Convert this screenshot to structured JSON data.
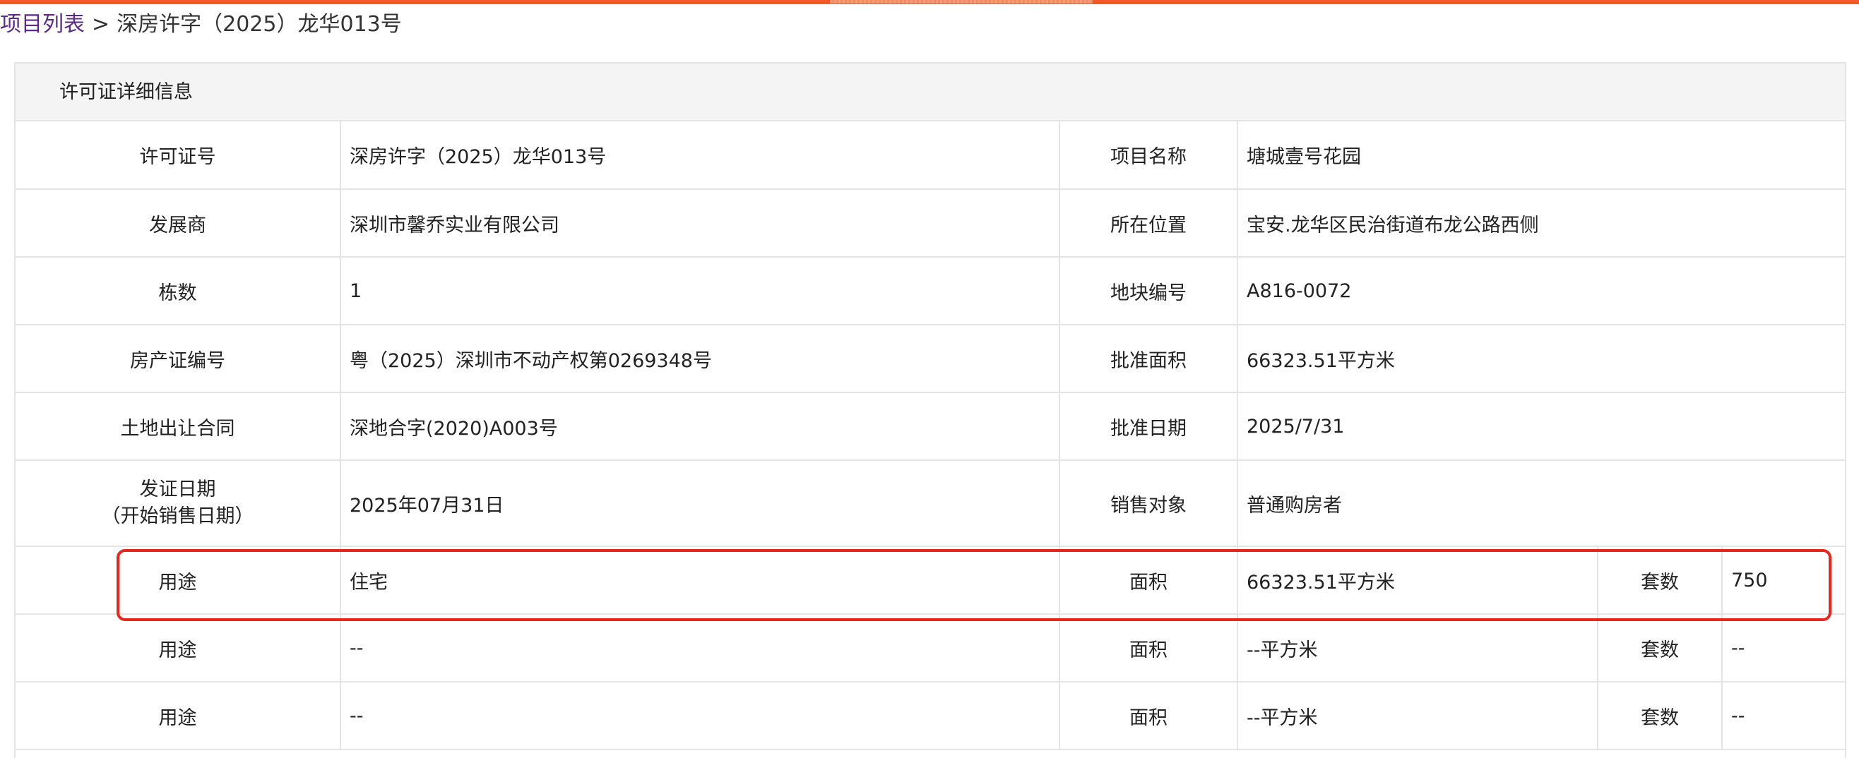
{
  "breadcrumb": {
    "link": "项目列表",
    "separator": ">",
    "current": "深房许字（2025）龙华013号"
  },
  "panel": {
    "title": "许可证详细信息"
  },
  "rows": [
    {
      "l1": "许可证号",
      "v1": "深房许字（2025）龙华013号",
      "l2": "项目名称",
      "v2": "塘城壹号花园"
    },
    {
      "l1": "发展商",
      "v1": "深圳市馨乔实业有限公司",
      "l2": "所在位置",
      "v2": "宝安.龙华区民治街道布龙公路西侧"
    },
    {
      "l1": "栋数",
      "v1": "1",
      "l2": "地块编号",
      "v2": "A816-0072"
    },
    {
      "l1": "房产证编号",
      "v1": "粤（2025）深圳市不动产权第0269348号",
      "l2": "批准面积",
      "v2": "66323.51平方米"
    },
    {
      "l1": "土地出让合同",
      "v1": "深地合字(2020)A003号",
      "l2": "批准日期",
      "v2": "2025/7/31"
    },
    {
      "l1a": "发证日期",
      "l1b": "（开始销售日期）",
      "v1": "2025年07月31日",
      "l2": "销售对象",
      "v2": "普通购房者"
    }
  ],
  "usage_rows": [
    {
      "use_label": "用途",
      "use": "住宅",
      "area_label": "面积",
      "area": "66323.51平方米",
      "units_label": "套数",
      "units": "750"
    },
    {
      "use_label": "用途",
      "use": "--",
      "area_label": "面积",
      "area": "--平方米",
      "units_label": "套数",
      "units": "--"
    },
    {
      "use_label": "用途",
      "use": "--",
      "area_label": "面积",
      "area": "--平方米",
      "units_label": "套数",
      "units": "--"
    }
  ],
  "colors": {
    "accent_bar": "#f15a24",
    "link": "#5a2a86",
    "highlight": "#e8261d"
  }
}
